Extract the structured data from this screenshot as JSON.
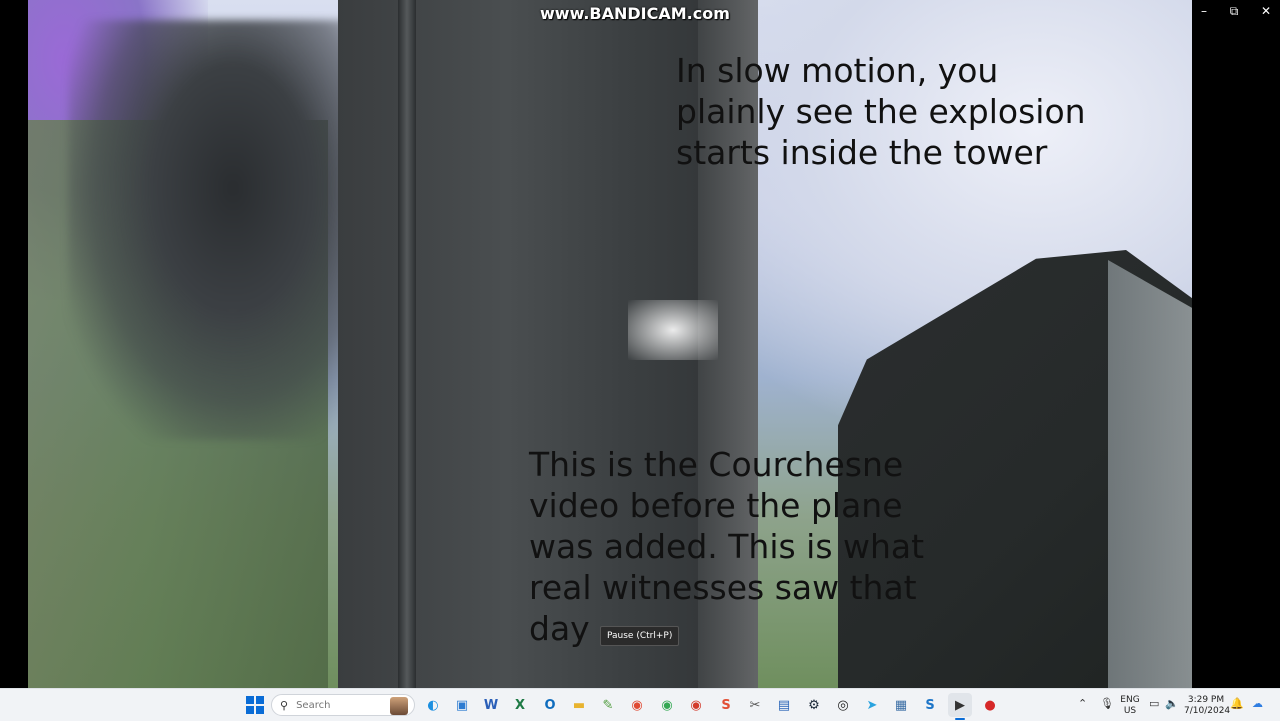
{
  "window": {
    "watermark": "www.BANDICAM.com",
    "controls": {
      "minimize": "–",
      "restore": "⧉",
      "close": "✕"
    }
  },
  "video": {
    "caption_top": "In slow motion, you\nplainly see the explosion\nstarts inside the tower",
    "caption_bottom": "This is the Courchesne\nvideo before the plane\nwas added. This is what\nreal witnesses saw that\nday",
    "tooltip": "Pause (Ctrl+P)"
  },
  "taskbar": {
    "search_placeholder": "Search",
    "apps": [
      {
        "name": "edge-icon",
        "glyph": "◐",
        "color": "#1b8fe0"
      },
      {
        "name": "photos-icon",
        "glyph": "▣",
        "color": "#2d7bd1"
      },
      {
        "name": "word-icon",
        "glyph": "W",
        "color": "#2b5fb8"
      },
      {
        "name": "excel-icon",
        "glyph": "X",
        "color": "#1f7a45"
      },
      {
        "name": "outlook-icon",
        "glyph": "O",
        "color": "#0f6cbd"
      },
      {
        "name": "file-explorer-icon",
        "glyph": "▬",
        "color": "#e8b32f"
      },
      {
        "name": "notepad-icon",
        "glyph": "✎",
        "color": "#4f9b3d"
      },
      {
        "name": "chrome-icon",
        "glyph": "◉",
        "color": "#e04a33"
      },
      {
        "name": "chrome-alt-icon",
        "glyph": "◉",
        "color": "#34a853"
      },
      {
        "name": "chrome-beta-icon",
        "glyph": "◉",
        "color": "#d33b2c"
      },
      {
        "name": "app-s-icon",
        "glyph": "S",
        "color": "#e24f35"
      },
      {
        "name": "paint-icon",
        "glyph": "✂",
        "color": "#555555"
      },
      {
        "name": "media-icon",
        "glyph": "▤",
        "color": "#2a64b8"
      },
      {
        "name": "steam-icon",
        "glyph": "⚙",
        "color": "#1b2838"
      },
      {
        "name": "chat-icon",
        "glyph": "◎",
        "color": "#222222"
      },
      {
        "name": "telegram-icon",
        "glyph": "➤",
        "color": "#2aa3df"
      },
      {
        "name": "image-viewer-icon",
        "glyph": "▦",
        "color": "#3b6ea5"
      },
      {
        "name": "skype-icon",
        "glyph": "S",
        "color": "#1d75c8"
      },
      {
        "name": "media-player-icon",
        "glyph": "▶",
        "color": "#333333"
      },
      {
        "name": "record-icon",
        "glyph": "●",
        "color": "#d62828"
      }
    ],
    "tray": {
      "language": "ENG",
      "region": "US",
      "time": "3:29 PM",
      "date": "7/10/2024"
    }
  }
}
